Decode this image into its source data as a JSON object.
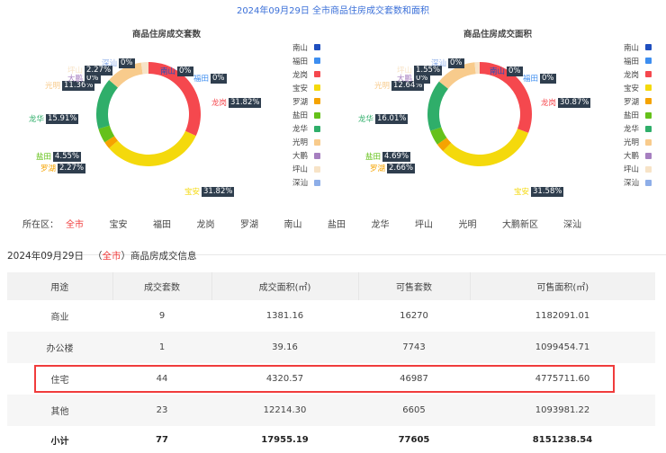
{
  "page_title": "2024年09月29日 全市商品住房成交套数和面积",
  "chart_data": [
    {
      "type": "pie",
      "title": "商品住房成交套数",
      "categories": [
        "南山",
        "福田",
        "龙岗",
        "宝安",
        "罗湖",
        "盐田",
        "龙华",
        "光明",
        "大鹏",
        "坪山",
        "深汕"
      ],
      "values": [
        0,
        0,
        31.82,
        31.82,
        2.27,
        4.55,
        15.91,
        11.36,
        0,
        2.27,
        0
      ],
      "labels": [
        "0%",
        "0%",
        "31.82%",
        "31.82%",
        "2.27%",
        "4.55%",
        "15.91%",
        "11.36%",
        "0%",
        "2.27%",
        "0%"
      ],
      "legend": "right"
    },
    {
      "type": "pie",
      "title": "商品住房成交面积",
      "categories": [
        "南山",
        "福田",
        "龙岗",
        "宝安",
        "罗湖",
        "盐田",
        "龙华",
        "光明",
        "大鹏",
        "坪山",
        "深汕"
      ],
      "values": [
        0,
        0,
        30.87,
        31.58,
        2.66,
        4.69,
        16.01,
        12.64,
        0,
        1.55,
        0
      ],
      "labels": [
        "0%",
        "0%",
        "30.87%",
        "31.58%",
        "2.66%",
        "4.69%",
        "16.01%",
        "12.64%",
        "0%",
        "1.55%",
        "0%"
      ],
      "legend": "right"
    }
  ],
  "colors": [
    "#1f4fbf",
    "#3d8ef0",
    "#f5484e",
    "#f4d90c",
    "#f5a300",
    "#65c11a",
    "#2fae6a",
    "#f8cb8c",
    "#a67fc0",
    "#f7e3c7",
    "#8eaee8"
  ],
  "district_filter": {
    "label": "所在区：",
    "items": [
      "全市",
      "宝安",
      "福田",
      "龙岗",
      "罗湖",
      "南山",
      "盐田",
      "龙华",
      "坪山",
      "光明",
      "大鹏新区",
      "深汕"
    ],
    "active": "全市"
  },
  "info": {
    "date": "2024年09月29日",
    "open": "（",
    "district": "全市",
    "close": "）商品房成交信息"
  },
  "table": {
    "headers": [
      "用途",
      "成交套数",
      "成交面积(㎡)",
      "可售套数",
      "可售面积(㎡)"
    ],
    "rows": [
      [
        "商业",
        "9",
        "1381.16",
        "16270",
        "1182091.01"
      ],
      [
        "办公楼",
        "1",
        "39.16",
        "7743",
        "1099454.71"
      ],
      [
        "住宅",
        "44",
        "4320.57",
        "46987",
        "4775711.60"
      ],
      [
        "其他",
        "23",
        "12214.30",
        "6605",
        "1093981.22"
      ],
      [
        "小计",
        "77",
        "17955.19",
        "77605",
        "8151238.54"
      ]
    ]
  }
}
